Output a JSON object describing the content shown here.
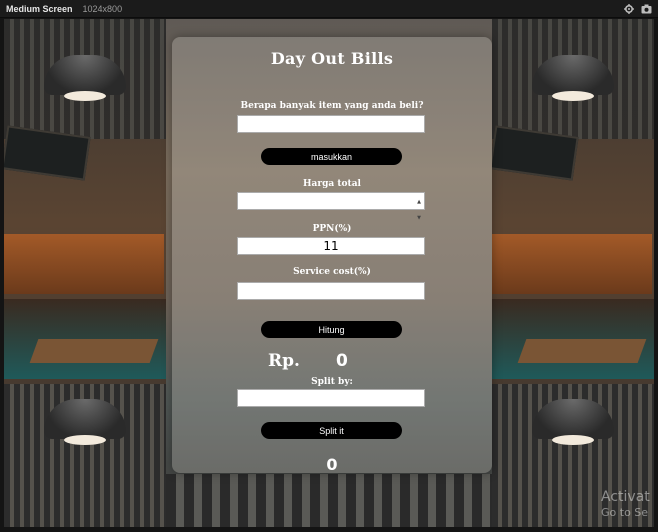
{
  "topbar": {
    "title": "Medium Screen",
    "size": "1024x800",
    "icons": [
      "gear-icon",
      "camera-icon"
    ]
  },
  "app": {
    "title": "Day Out Bills",
    "items_label": "Berapa banyak item yang anda beli?",
    "items_value": "",
    "masukkan_label": "masukkan",
    "harga_label": "Harga total",
    "harga_value": "",
    "ppn_label": "PPN(%)",
    "ppn_value": "11",
    "service_label": "Service cost(%)",
    "service_value": "",
    "hitung_label": "Hitung",
    "currency": "Rp.",
    "total_value": "0",
    "split_label": "Split by:",
    "split_value": "",
    "split_button_label": "Split it",
    "split_result": "0"
  },
  "watermark": {
    "line1": "Activat",
    "line2": "Go to Se"
  },
  "colors": {
    "button_bg": "#000000",
    "field_bg": "#ffffff",
    "heading": "#ffffff"
  }
}
